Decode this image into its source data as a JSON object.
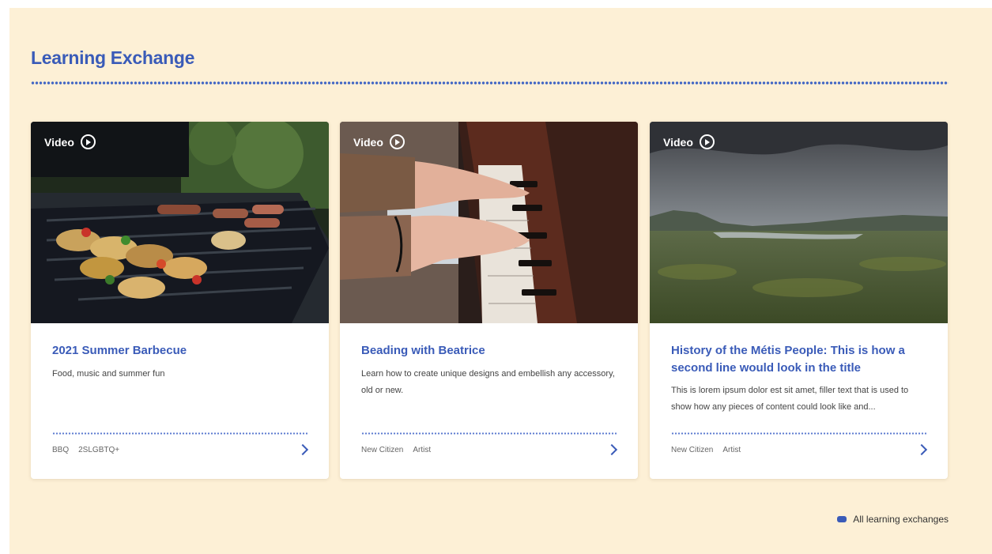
{
  "section": {
    "title": "Learning Exchange"
  },
  "cards": [
    {
      "badge": "Video",
      "title": "2021 Summer Barbecue",
      "description": "Food, music and summer fun",
      "tags": [
        "BBQ",
        "2SLGBTQ+"
      ]
    },
    {
      "badge": "Video",
      "title": "Beading with Beatrice",
      "description": "Learn how to create unique designs and embellish any accessory, old or new.",
      "tags": [
        "New Citizen",
        "Artist"
      ]
    },
    {
      "badge": "Video",
      "title": "History of the Métis People: This is how a second line would look in the title",
      "description": "This is lorem ipsum dolor est sit amet, filler text that is used to show how any pieces of content could look like and...",
      "tags": [
        "New Citizen",
        "Artist"
      ]
    }
  ],
  "footer": {
    "all_link": "All learning exchanges"
  },
  "colors": {
    "accent": "#3a5bb8",
    "background": "#fdf0d6",
    "card": "#ffffff"
  }
}
